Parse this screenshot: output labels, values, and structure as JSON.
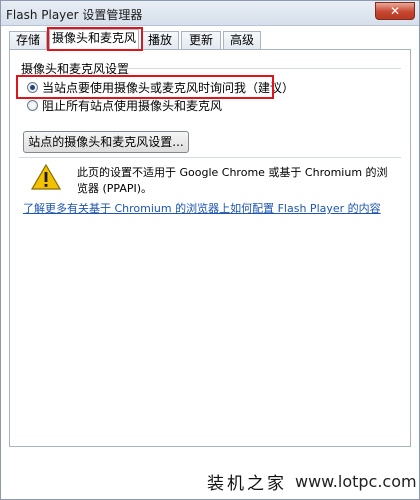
{
  "window": {
    "title": "Flash Player 设置管理器",
    "close_glyph": "✕"
  },
  "tabs": [
    {
      "label": "存储",
      "active": false
    },
    {
      "label": "摄像头和麦克风",
      "active": true
    },
    {
      "label": "播放",
      "active": false
    },
    {
      "label": "更新",
      "active": false
    },
    {
      "label": "高级",
      "active": false
    }
  ],
  "camera_settings": {
    "group_title": "摄像头和麦克风设置",
    "options": [
      {
        "label": "当站点要使用摄像头或麦克风时询问我（建议）",
        "checked": true
      },
      {
        "label": "阻止所有站点使用摄像头和麦克风",
        "checked": false
      }
    ],
    "site_settings_button": "站点的摄像头和麦克风设置..."
  },
  "notice": {
    "icon": "warning-icon",
    "text": "此页的设置不适用于 Google Chrome 或基于 Chromium 的浏览器 (PPAPI)。",
    "link": "了解更多有关基于 Chromium 的浏览器上如何配置 Flash Player 的内容"
  },
  "watermark": {
    "brand": "装机之家",
    "url": "www.lotpc.com"
  },
  "colors": {
    "highlight_red": "#e0141b",
    "link_blue": "#1d55b3",
    "warning_yellow": "#f2c200"
  }
}
